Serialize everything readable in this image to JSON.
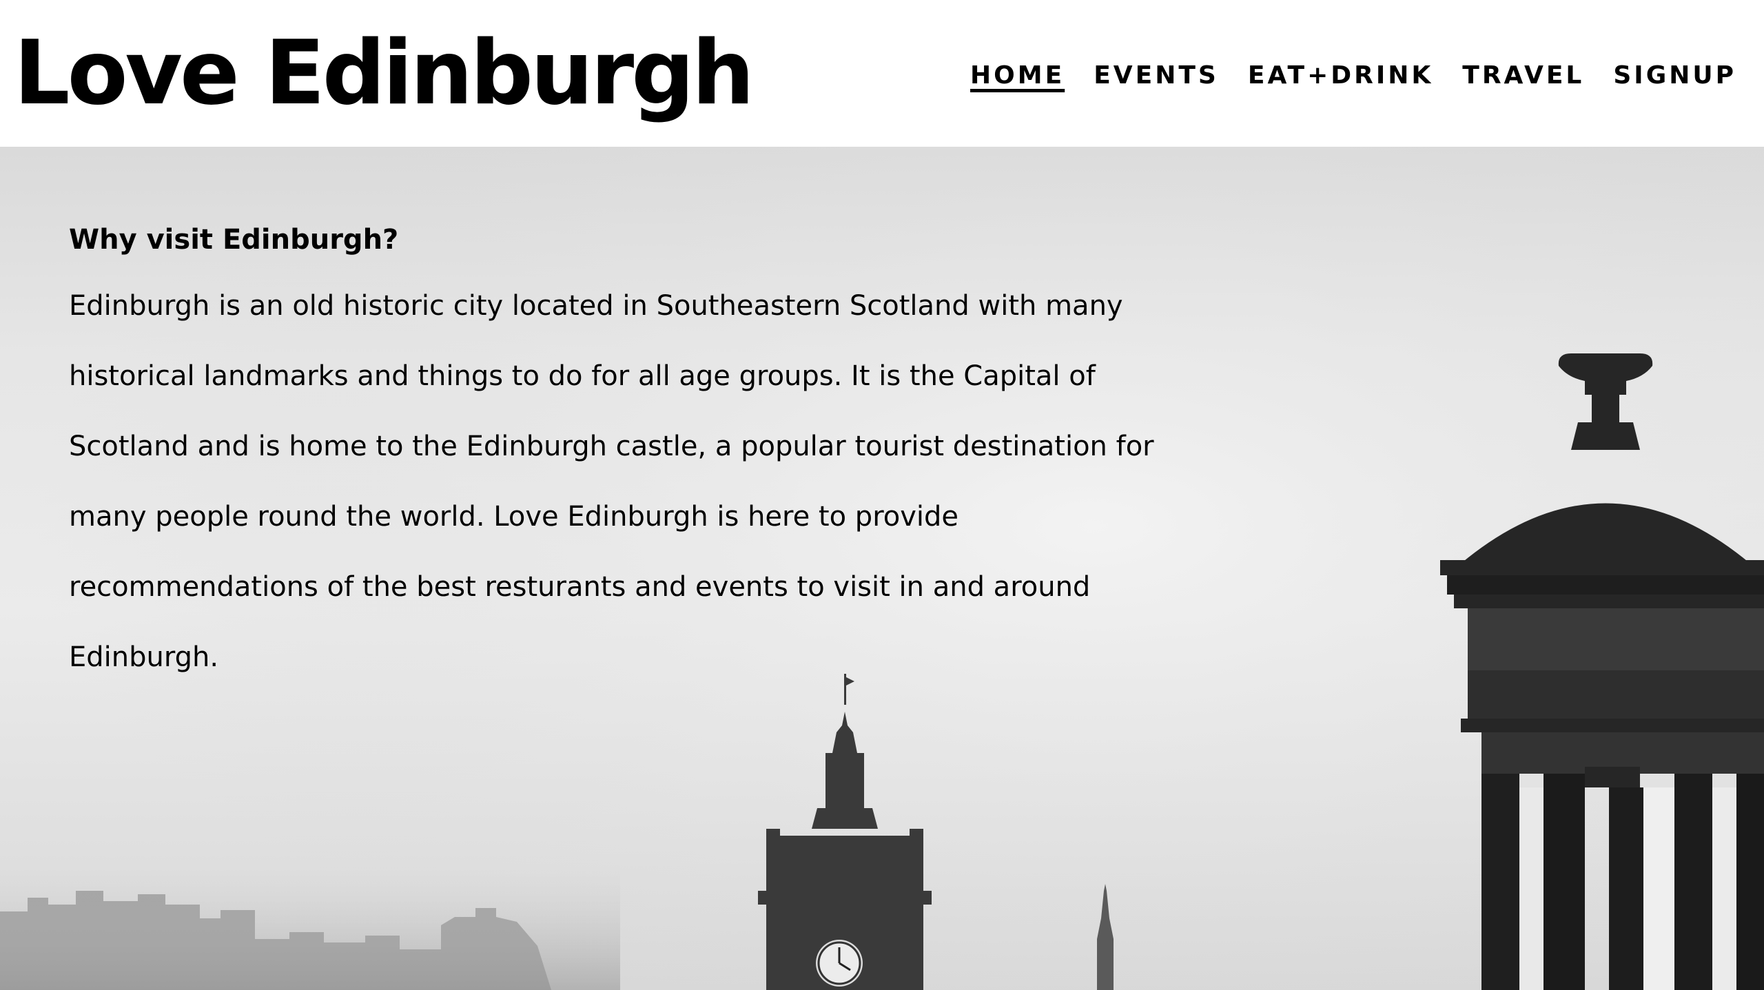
{
  "header": {
    "site_title": "Love Edinburgh",
    "nav": [
      {
        "label": "HOME",
        "active": true
      },
      {
        "label": "EVENTS",
        "active": false
      },
      {
        "label": "EAT+DRINK",
        "active": false
      },
      {
        "label": "TRAVEL",
        "active": false
      },
      {
        "label": "SIGNUP",
        "active": false
      }
    ]
  },
  "main": {
    "heading": "Why visit Edinburgh?",
    "paragraph": "Edinburgh is an old historic city located in Southeastern Scotland with many historical landmarks and things to do for all age groups. It is the Capital of Scotland and is home to the Edinburgh castle, a popular tourist destination for many people round the world. Love Edinburgh is here to provide recommendations of the best resturants and events to visit in and around Edinburgh."
  },
  "hero_image": {
    "subject": "Edinburgh skyline with Dugald Stewart Monument and Balmoral clock tower",
    "style": "black and white"
  },
  "colors": {
    "text": "#000000",
    "header_bg": "#ffffff",
    "hero_sky": "#e6e6e6",
    "silhouette": "#2a2a2a"
  }
}
